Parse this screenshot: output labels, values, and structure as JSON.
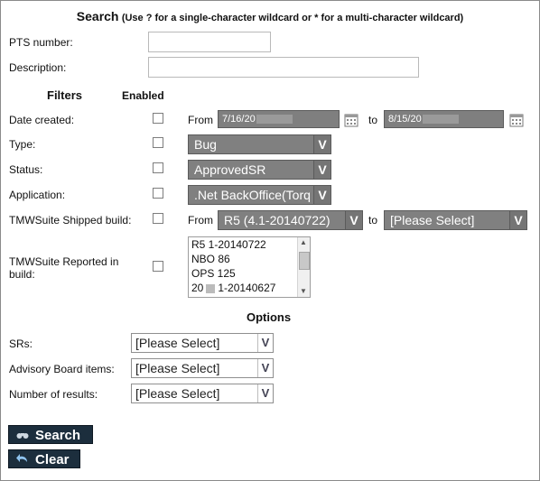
{
  "search_header": {
    "title": "Search",
    "hint": "(Use ? for a single-character wildcard or * for a multi-character wildcard)"
  },
  "fields": {
    "pts_number": {
      "label": "PTS number:",
      "value": ""
    },
    "description": {
      "label": "Description:",
      "value": ""
    }
  },
  "filters": {
    "heading": "Filters",
    "enabled_heading": "Enabled",
    "date_created": {
      "label": "Date created:",
      "from_label": "From",
      "from_value": "7/16/20",
      "to_label": "to",
      "to_value": "8/15/20"
    },
    "type": {
      "label": "Type:",
      "value": "Bug"
    },
    "status": {
      "label": "Status:",
      "value": "ApprovedSR"
    },
    "application": {
      "label": "Application:",
      "value": ".Net BackOffice(Torq"
    },
    "shipped_build": {
      "label": "TMWSuite Shipped build:",
      "from_label": "From",
      "from_value": "R5 (4.1-20140722)",
      "to_label": "to",
      "to_value": "[Please Select]"
    },
    "reported_build": {
      "label_line1": "TMWSuite Reported in",
      "label_line2": "build:",
      "items": [
        "R5 1-20140722",
        "NBO 86",
        "OPS 125",
        "20",
        "1-20140627"
      ]
    }
  },
  "options": {
    "heading": "Options",
    "srs": {
      "label": "SRs:",
      "value": "[Please Select]"
    },
    "advisory": {
      "label": "Advisory Board items:",
      "value": "[Please Select]"
    },
    "results": {
      "label": "Number of results:",
      "value": "[Please Select]"
    }
  },
  "buttons": {
    "search": "Search",
    "clear": "Clear"
  },
  "icons": {
    "calendar": "calendar-icon",
    "dropdown": "chevron-down-icon",
    "search": "binoculars-icon",
    "clear": "undo-arrow-icon"
  },
  "colors": {
    "button_bg": "#1c2e3d",
    "dark_select_bg": "#808080"
  }
}
